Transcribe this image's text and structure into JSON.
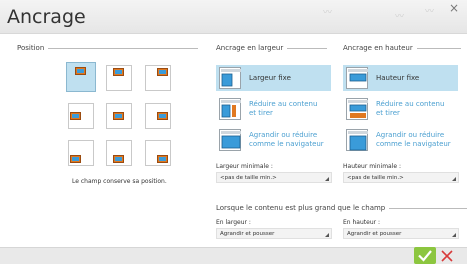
{
  "window": {
    "title": "Ancrage",
    "close_glyph": "×"
  },
  "position": {
    "legend": "Position",
    "caption": "Le champ conserve sa position.",
    "selected_index": 0
  },
  "width_anchor": {
    "legend": "Ancrage en largeur",
    "options": [
      {
        "label": "Largeur fixe",
        "selected": true
      },
      {
        "label": "Réduire au contenu et tirer",
        "selected": false
      },
      {
        "label": "Agrandir ou réduire comme le navigateur",
        "selected": false
      }
    ],
    "min_label": "Largeur minimale :",
    "min_value": "<pas de taille min.>"
  },
  "height_anchor": {
    "legend": "Ancrage en hauteur",
    "options": [
      {
        "label": "Hauteur fixe",
        "selected": true
      },
      {
        "label": "Réduire au contenu et tirer",
        "selected": false
      },
      {
        "label": "Agrandir ou réduire comme le navigateur",
        "selected": false
      }
    ],
    "min_label": "Hauteur minimale :",
    "min_value": "<pas de taille min.>"
  },
  "overflow": {
    "legend": "Lorsque le contenu est plus grand que le champ",
    "width_label": "En largeur :",
    "width_value": "Agrandir et pousser",
    "height_label": "En hauteur :",
    "height_value": "Agrandir et pousser"
  },
  "buttons": {
    "ok_icon": "check-icon",
    "cancel_icon": "cross-icon"
  },
  "colors": {
    "accent_selected": "#bfe0f0",
    "orange": "#e07820",
    "blue": "#3a9bd9",
    "ok_green": "#8cc63f",
    "cancel_red": "#d83a3a",
    "link_blue": "#4a9fd0"
  }
}
